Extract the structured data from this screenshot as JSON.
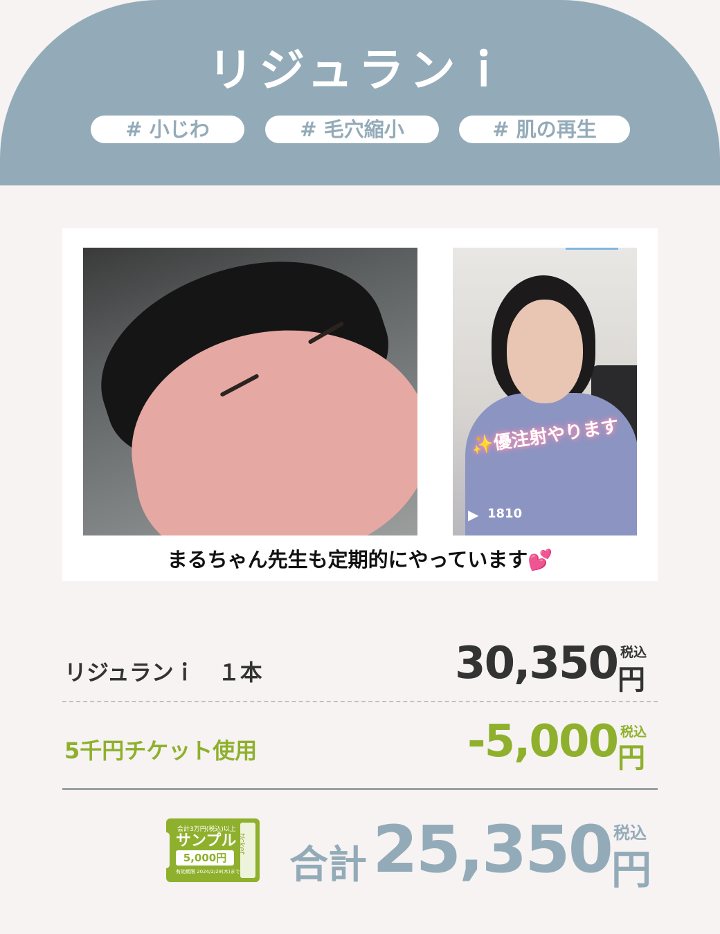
{
  "header": {
    "title": "リジュランｉ",
    "tags": [
      "# 小じわ",
      "# 毛穴縮小",
      "# 肌の再生"
    ]
  },
  "gallery": {
    "video_overlay_text": "✨優注射やります",
    "video_view_count": "1810",
    "caption": "まるちゃん先生も定期的にやっています💕"
  },
  "pricing": {
    "item": {
      "label": "リジュランｉ　１本",
      "amount": "30,350",
      "currency": "円",
      "tax_note": "税込"
    },
    "discount": {
      "label": "5千円チケット使用",
      "amount": "-5,000",
      "currency": "円",
      "tax_note": "税込"
    },
    "total": {
      "label": "合計",
      "amount": "25,350",
      "currency": "円",
      "tax_note": "税込"
    }
  },
  "ticket": {
    "top_text": "会計3万円(税込)以上",
    "sample_text": "サンプル",
    "amount": "5,000円",
    "expiry": "有効期限 2024/2/29(木)まで",
    "script": "ticket"
  },
  "colors": {
    "accent_blue": "#93abb8",
    "accent_green": "#8fb02d",
    "background": "#f6f3f2"
  }
}
